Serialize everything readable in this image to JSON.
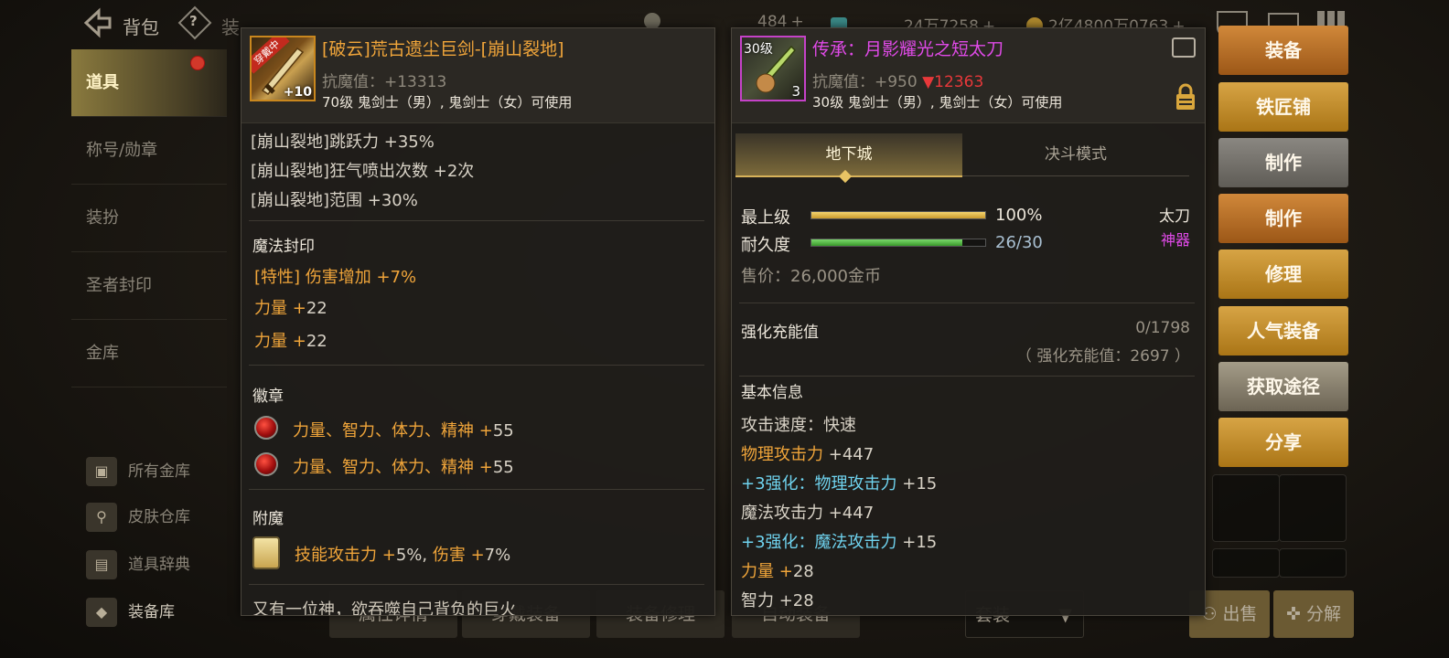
{
  "topbar": {
    "title": "背包",
    "help": "?",
    "tab_partial": "装",
    "cur1": "484",
    "cur2": "24万7258",
    "cur3": "2亿4800万0763",
    "plus": "+"
  },
  "sidebar": {
    "items": [
      "道具",
      "称号/勋章",
      "装扮",
      "圣者封印",
      "金库"
    ],
    "links": [
      "所有金库",
      "皮肤仓库",
      "道具辞典",
      "装备库"
    ]
  },
  "left_panel": {
    "badge": "穿戴中",
    "enhance": "+10",
    "title": "[破云]荒古遗尘巨剑-[崩山裂地]",
    "anti_magic": "抗魔值：+13313",
    "requirement": "70级 鬼剑士（男）, 鬼剑士（女）可使用",
    "skill_lines": [
      "[崩山裂地]跳跃力 +35%",
      "[崩山裂地]狂气喷出次数 +2次",
      "[崩山裂地]范围 +30%"
    ],
    "seal_title": "魔法封印",
    "seal_lines": [
      {
        "a": "[特性]",
        "b": " 伤害增加 ",
        "c": "+7%"
      },
      {
        "a": "力量 ",
        "b": "+",
        "c": "22"
      },
      {
        "a": "力量 ",
        "b": "+",
        "c": "22"
      }
    ],
    "emblem_title": "徽章",
    "emblem_lines": [
      {
        "a": "力量、智力、体力、精神 ",
        "b": "+",
        "c": "55"
      },
      {
        "a": "力量、智力、体力、精神 ",
        "b": "+",
        "c": "55"
      }
    ],
    "enchant_title": "附魔",
    "enchant_line": {
      "a": "技能攻击力 ",
      "b": "+",
      "c": "5%, ",
      "d": "伤害 ",
      "e": "+",
      "f": "7%"
    },
    "flavor_partial": "又有一位神，欲吞噬自己背负的巨火"
  },
  "right_panel": {
    "level_badge": "30级",
    "count": "3",
    "title": "传承：月影耀光之短太刀",
    "anti_magic": "抗魔值：+950",
    "anti_magic_diff": "▼12363",
    "requirement": "30级 鬼剑士（男）, 鬼剑士（女）可使用",
    "tabs": [
      "地下城",
      "决斗模式"
    ],
    "grade_label": "最上级",
    "grade_value": "100%",
    "grade_fraction": 1.0,
    "durability_label": "耐久度",
    "durability_value": "26/30",
    "durability_fraction": 0.8667,
    "weapon_type": "太刀",
    "rarity": "神器",
    "price": "售价：26,000金币",
    "enhance_label": "强化充能值",
    "enhance_value": "0/1798",
    "enhance_note": "（ 强化充能值：2697 ）",
    "basic_title": "基本信息",
    "stats": [
      {
        "a": "攻击速度：快速",
        "b": "",
        "c": "",
        "d": ""
      },
      {
        "a": "",
        "b": "物理攻击力",
        "c": " +",
        "d": "447"
      },
      {
        "a": "+3强化：",
        "b": "物理攻击力",
        "c": " +",
        "d": "15"
      },
      {
        "a": "魔法攻击力 +447",
        "b": "",
        "c": "",
        "d": ""
      },
      {
        "a": "+3强化：",
        "b": "魔法攻击力",
        "c": " +",
        "d": "15"
      },
      {
        "a": "",
        "b": "力量",
        "c": " +",
        "d": "28"
      },
      {
        "a": "智力 +28",
        "b": "",
        "c": "",
        "d": ""
      }
    ]
  },
  "right_buttons": [
    "装备",
    "铁匠铺",
    "制作",
    "制作",
    "修理",
    "人气装备",
    "获取途径",
    "分享"
  ],
  "bottom": {
    "buttons": [
      "属性详情",
      "穿戴装备",
      "装备修理",
      "自动装备"
    ],
    "set_label": "套装",
    "sell": "出售",
    "dismantle": "分解"
  },
  "colors": {
    "orange": "#f0a53a",
    "cyan": "#6fd3ef",
    "magenta": "#e04ae8",
    "red": "#e8383a"
  }
}
